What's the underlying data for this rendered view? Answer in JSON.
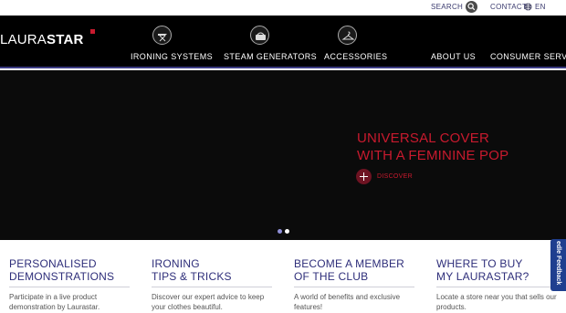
{
  "topbar": {
    "search_label": "SEARCH",
    "contact_label": "CONTACT",
    "language": "EN"
  },
  "header": {
    "logo_light": "LAURA",
    "logo_bold": "STAR"
  },
  "nav": {
    "items": [
      {
        "label": "IRONING SYSTEMS",
        "icon": "ironing-board-icon"
      },
      {
        "label": "STEAM GENERATORS",
        "icon": "steam-generator-icon"
      },
      {
        "label": "ACCESSORIES",
        "icon": "hanger-icon"
      },
      {
        "label": "ABOUT US"
      },
      {
        "label": "CONSUMER SERVICE"
      }
    ]
  },
  "hero": {
    "title_line1": "UNIVERSAL COVER",
    "title_line2": "WITH A FEMININE POP",
    "cta_label": "DISCOVER",
    "slides_total": 2,
    "active_slide": 2
  },
  "features": [
    {
      "title_line1": "PERSONALISED",
      "title_line2": "DEMONSTRATIONS",
      "text": "Participate in a live product demonstration by Laurastar."
    },
    {
      "title_line1": "IRONING",
      "title_line2": "TIPS & TRICKS",
      "text": "Discover our expert advice to keep your clothes beautiful."
    },
    {
      "title_line1": "BECOME A MEMBER",
      "title_line2": "OF THE CLUB",
      "text": "A world of benefits and exclusive features!"
    },
    {
      "title_line1": "WHERE TO BUY",
      "title_line2": "MY LAURASTAR?",
      "text": "Locate a store near you that sells our products."
    }
  ],
  "feedback_tab": {
    "label": "edle Feedback"
  },
  "colors": {
    "accent_red": "#c81a2e",
    "nav_underline": "#3b3b82",
    "feature_title": "#2e2e7a",
    "feedback_bg": "#1f3f8f"
  }
}
